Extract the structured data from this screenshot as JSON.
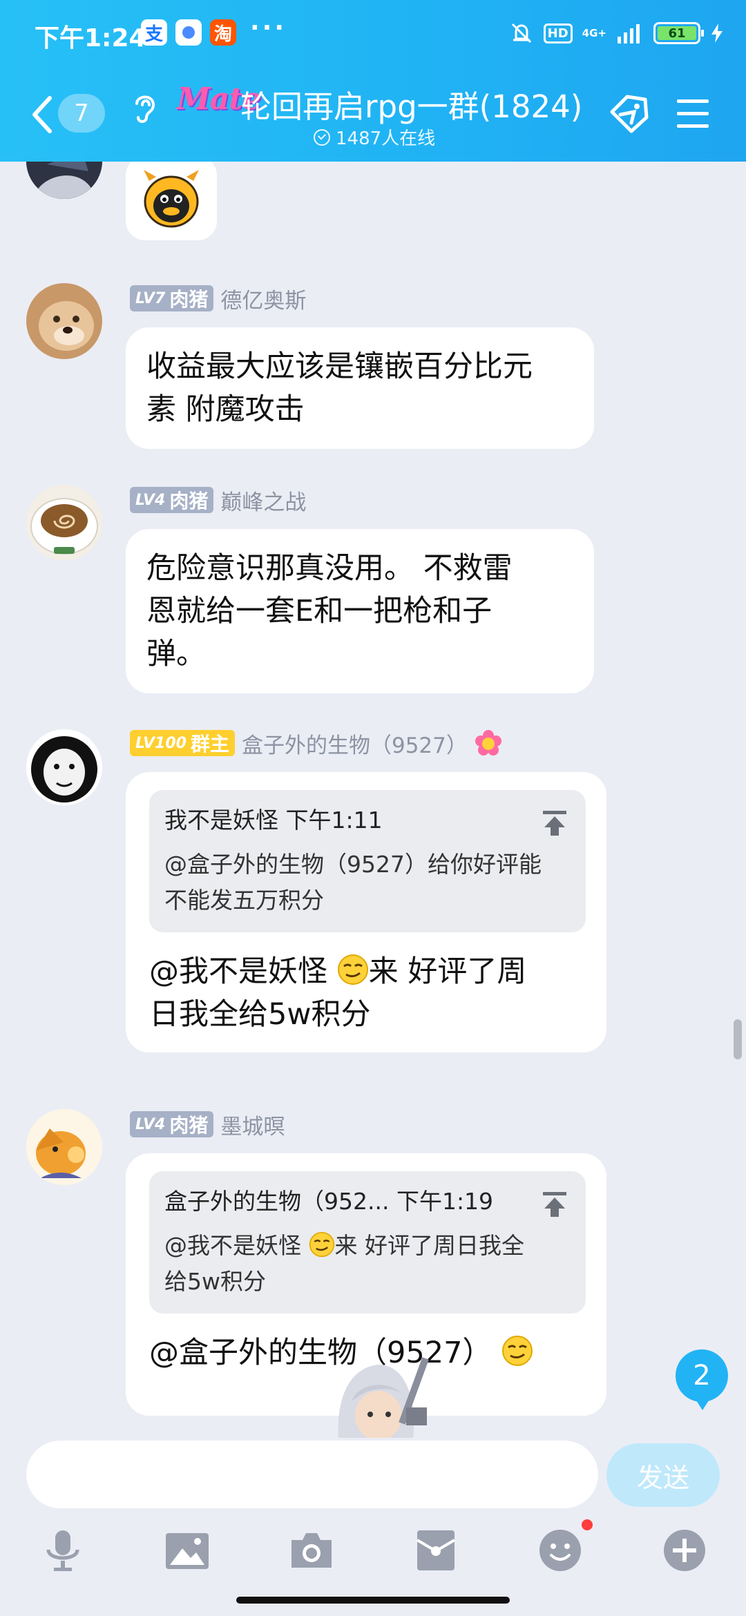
{
  "status_bar": {
    "time": "下午1:24",
    "apps": [
      {
        "icon": "alipay-icon",
        "glyph": "支",
        "color": "#1677ff"
      },
      {
        "icon": "chat-app-icon",
        "glyph": "",
        "color": "#4a8bff"
      },
      {
        "icon": "taobao-icon",
        "glyph": "淘",
        "color": "#ff5500"
      }
    ],
    "more": "···",
    "hd": "HD",
    "network": "4G+",
    "battery": "61"
  },
  "header": {
    "unread_count": "7",
    "logo_text": "Mate",
    "title": "轮回再启rpg一群(1824)",
    "online": "1487人在线"
  },
  "messages": [
    {
      "sender": "",
      "sticker": "penguin-cow-sticker"
    },
    {
      "level": "LV7",
      "role": "肉猪",
      "sender": "德亿奥斯",
      "lines": [
        "收益最大应该是镶嵌百分比元",
        "素  附魔攻击"
      ]
    },
    {
      "level": "LV4",
      "role": "肉猪",
      "sender": "巅峰之战",
      "lines": [
        "危险意识那真没用。 不救雷",
        "恩就给一套E和一把枪和子",
        "弹。"
      ]
    },
    {
      "level": "LV100",
      "role": "群主",
      "sender": "盒子外的生物（9527）",
      "quote": {
        "author_time": "我不是妖怪 下午1:11",
        "lines": [
          "@盒子外的生物（9527）给你好评能",
          "不能发五万积分"
        ]
      },
      "line1_a": "@我不是妖怪 ",
      "line1_b": "来 好评了周",
      "line2": "日我全给5w积分"
    },
    {
      "level": "LV4",
      "role": "肉猪",
      "sender": "墨城暝",
      "quote": {
        "author_time": "盒子外的生物（952... 下午1:19",
        "line1_a": "@我不是妖怪 ",
        "line1_b": "来 好评了周日我全",
        "line2": "给5w积分"
      },
      "text": "@盒子外的生物（9527）"
    }
  ],
  "new_messages_badge": "2",
  "input": {
    "placeholder": "",
    "send_label": "发送"
  },
  "toolbar": [
    "microphone-icon",
    "image-icon",
    "camera-icon",
    "red-packet-icon",
    "emoji-icon",
    "plus-icon"
  ],
  "colors": {
    "header": "#22b3f5",
    "background": "#ebedf5",
    "level_badge": "#a6b0c6",
    "owner_badge": "#ffcf2f"
  }
}
